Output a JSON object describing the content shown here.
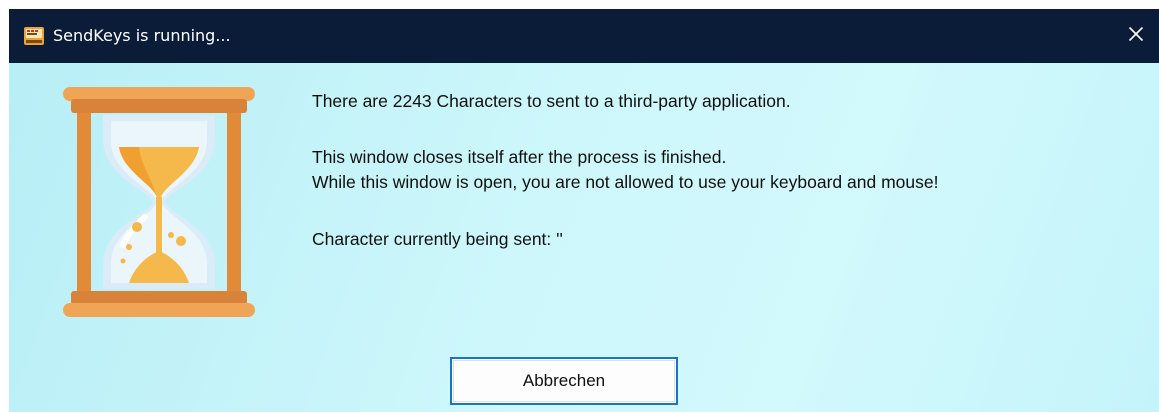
{
  "window": {
    "title": "SendKeys is running...",
    "app_icon": "sendkeys-app-icon",
    "close_icon": "close-icon"
  },
  "content": {
    "illustration": "hourglass-icon",
    "line1": "There are 2243 Characters to sent to a third-party application.",
    "line2": "This window closes itself after the process is finished.",
    "line3": "While this window is open, you are not allowed to use your keyboard and mouse!",
    "line4": "Character currently being sent: ''"
  },
  "buttons": {
    "cancel_label": "Abbrechen"
  },
  "colors": {
    "titlebar": "#0a1c38",
    "client_background": "#c8f5fa",
    "button_border": "#1e73c7",
    "hourglass_frame": "#e08a3a",
    "hourglass_sand": "#f5b84a"
  }
}
